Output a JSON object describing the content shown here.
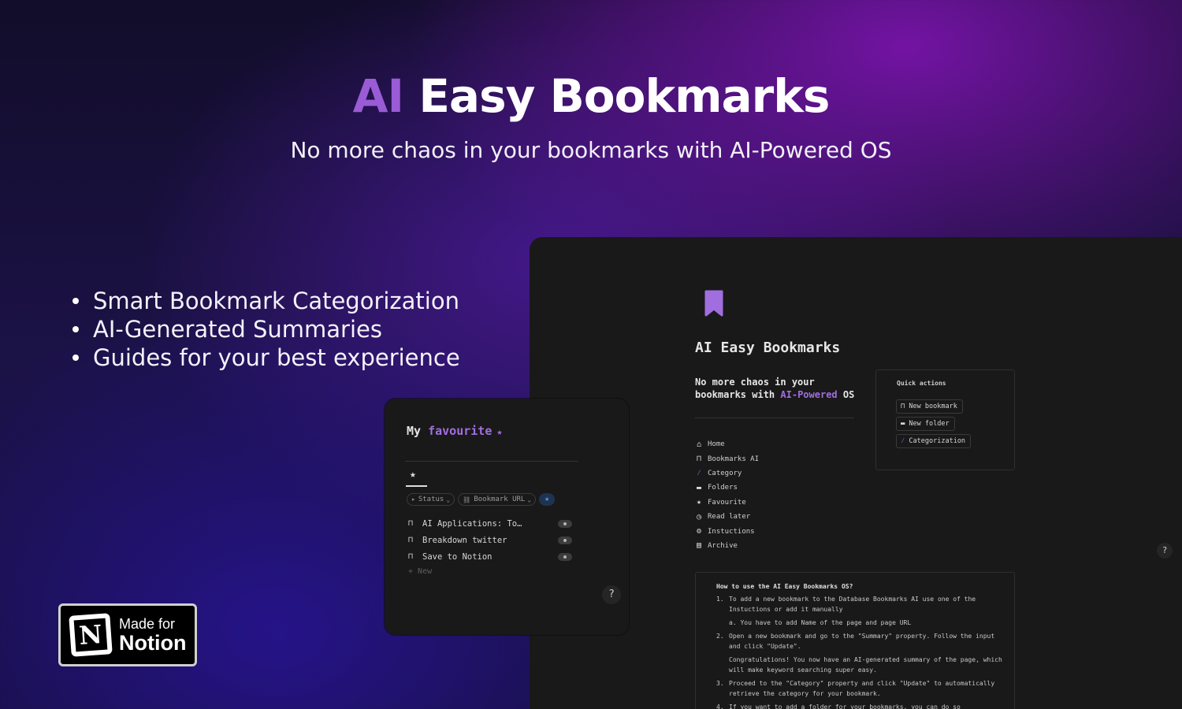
{
  "hero": {
    "title_accent": "AI",
    "title_rest": "Easy Bookmarks",
    "subtitle": "No more chaos in your bookmarks with AI-Powered OS"
  },
  "features": [
    "Smart Bookmark Categorization",
    "AI-Generated Summaries",
    "Guides for your best experience"
  ],
  "badge": {
    "logo_letter": "N",
    "line1": "Made for",
    "line2": "Notion"
  },
  "panel": {
    "title": "AI Easy Bookmarks",
    "tagline_a": "No more chaos in your bookmarks with",
    "tagline_accent": "AI-Powered",
    "tagline_b": "OS",
    "nav": [
      {
        "icon": "home-icon",
        "label": "Home"
      },
      {
        "icon": "bookmark-icon",
        "label": "Bookmarks AI"
      },
      {
        "icon": "magic-wand-icon",
        "label": "Category"
      },
      {
        "icon": "folder-icon",
        "label": "Folders"
      },
      {
        "icon": "star-icon",
        "label": "Favourite"
      },
      {
        "icon": "clock-icon",
        "label": "Read later"
      },
      {
        "icon": "gears-icon",
        "label": "Instuctions"
      },
      {
        "icon": "archive-icon",
        "label": "Archive"
      }
    ],
    "quick_actions": {
      "title": "Quick actions",
      "buttons": [
        "New bookmark",
        "New folder",
        "Categorization"
      ]
    },
    "howto": {
      "title": "How to use the AI Easy Bookmarks OS?",
      "s1_num": "1.",
      "s1_a": "To add a new bookmark to the Database",
      "s1_link1": "Bookmarks AI",
      "s1_b": "use one of the",
      "s1_link2": "Instuctions",
      "s1_c": "or add it manually",
      "s1_sub": "a. You have to add Name of the page and page URL",
      "s2_num": "2.",
      "s2": "Open a new bookmark and go to the \"Summary\" property. Follow the input and click \"Update\".",
      "s2_b": "Congratulations! You now have an AI-generated summary of the page, which will make keyword searching super easy.",
      "s3_num": "3.",
      "s3": "Proceed to the \"Category\" property and click \"Update\" to automatically retrieve the category for your bookmark.",
      "s4_num": "4.",
      "s4": "If you want to add a folder for your bookmarks, you can do so"
    },
    "help": "?"
  },
  "favourite": {
    "title_a": "My",
    "title_accent": "favourite",
    "title_star": "★",
    "tab_star": "★",
    "filters": [
      "Status",
      "Bookmark URL"
    ],
    "rows": [
      "AI Applications: To…",
      "Breakdown twitter",
      "Save to Notion"
    ],
    "new_label": "New",
    "help": "?"
  },
  "colors": {
    "accent_purple": "#a16ee0",
    "title_accent": "#9a5bd6",
    "panel_bg": "#191919",
    "star_blue": "#4a9aef"
  }
}
